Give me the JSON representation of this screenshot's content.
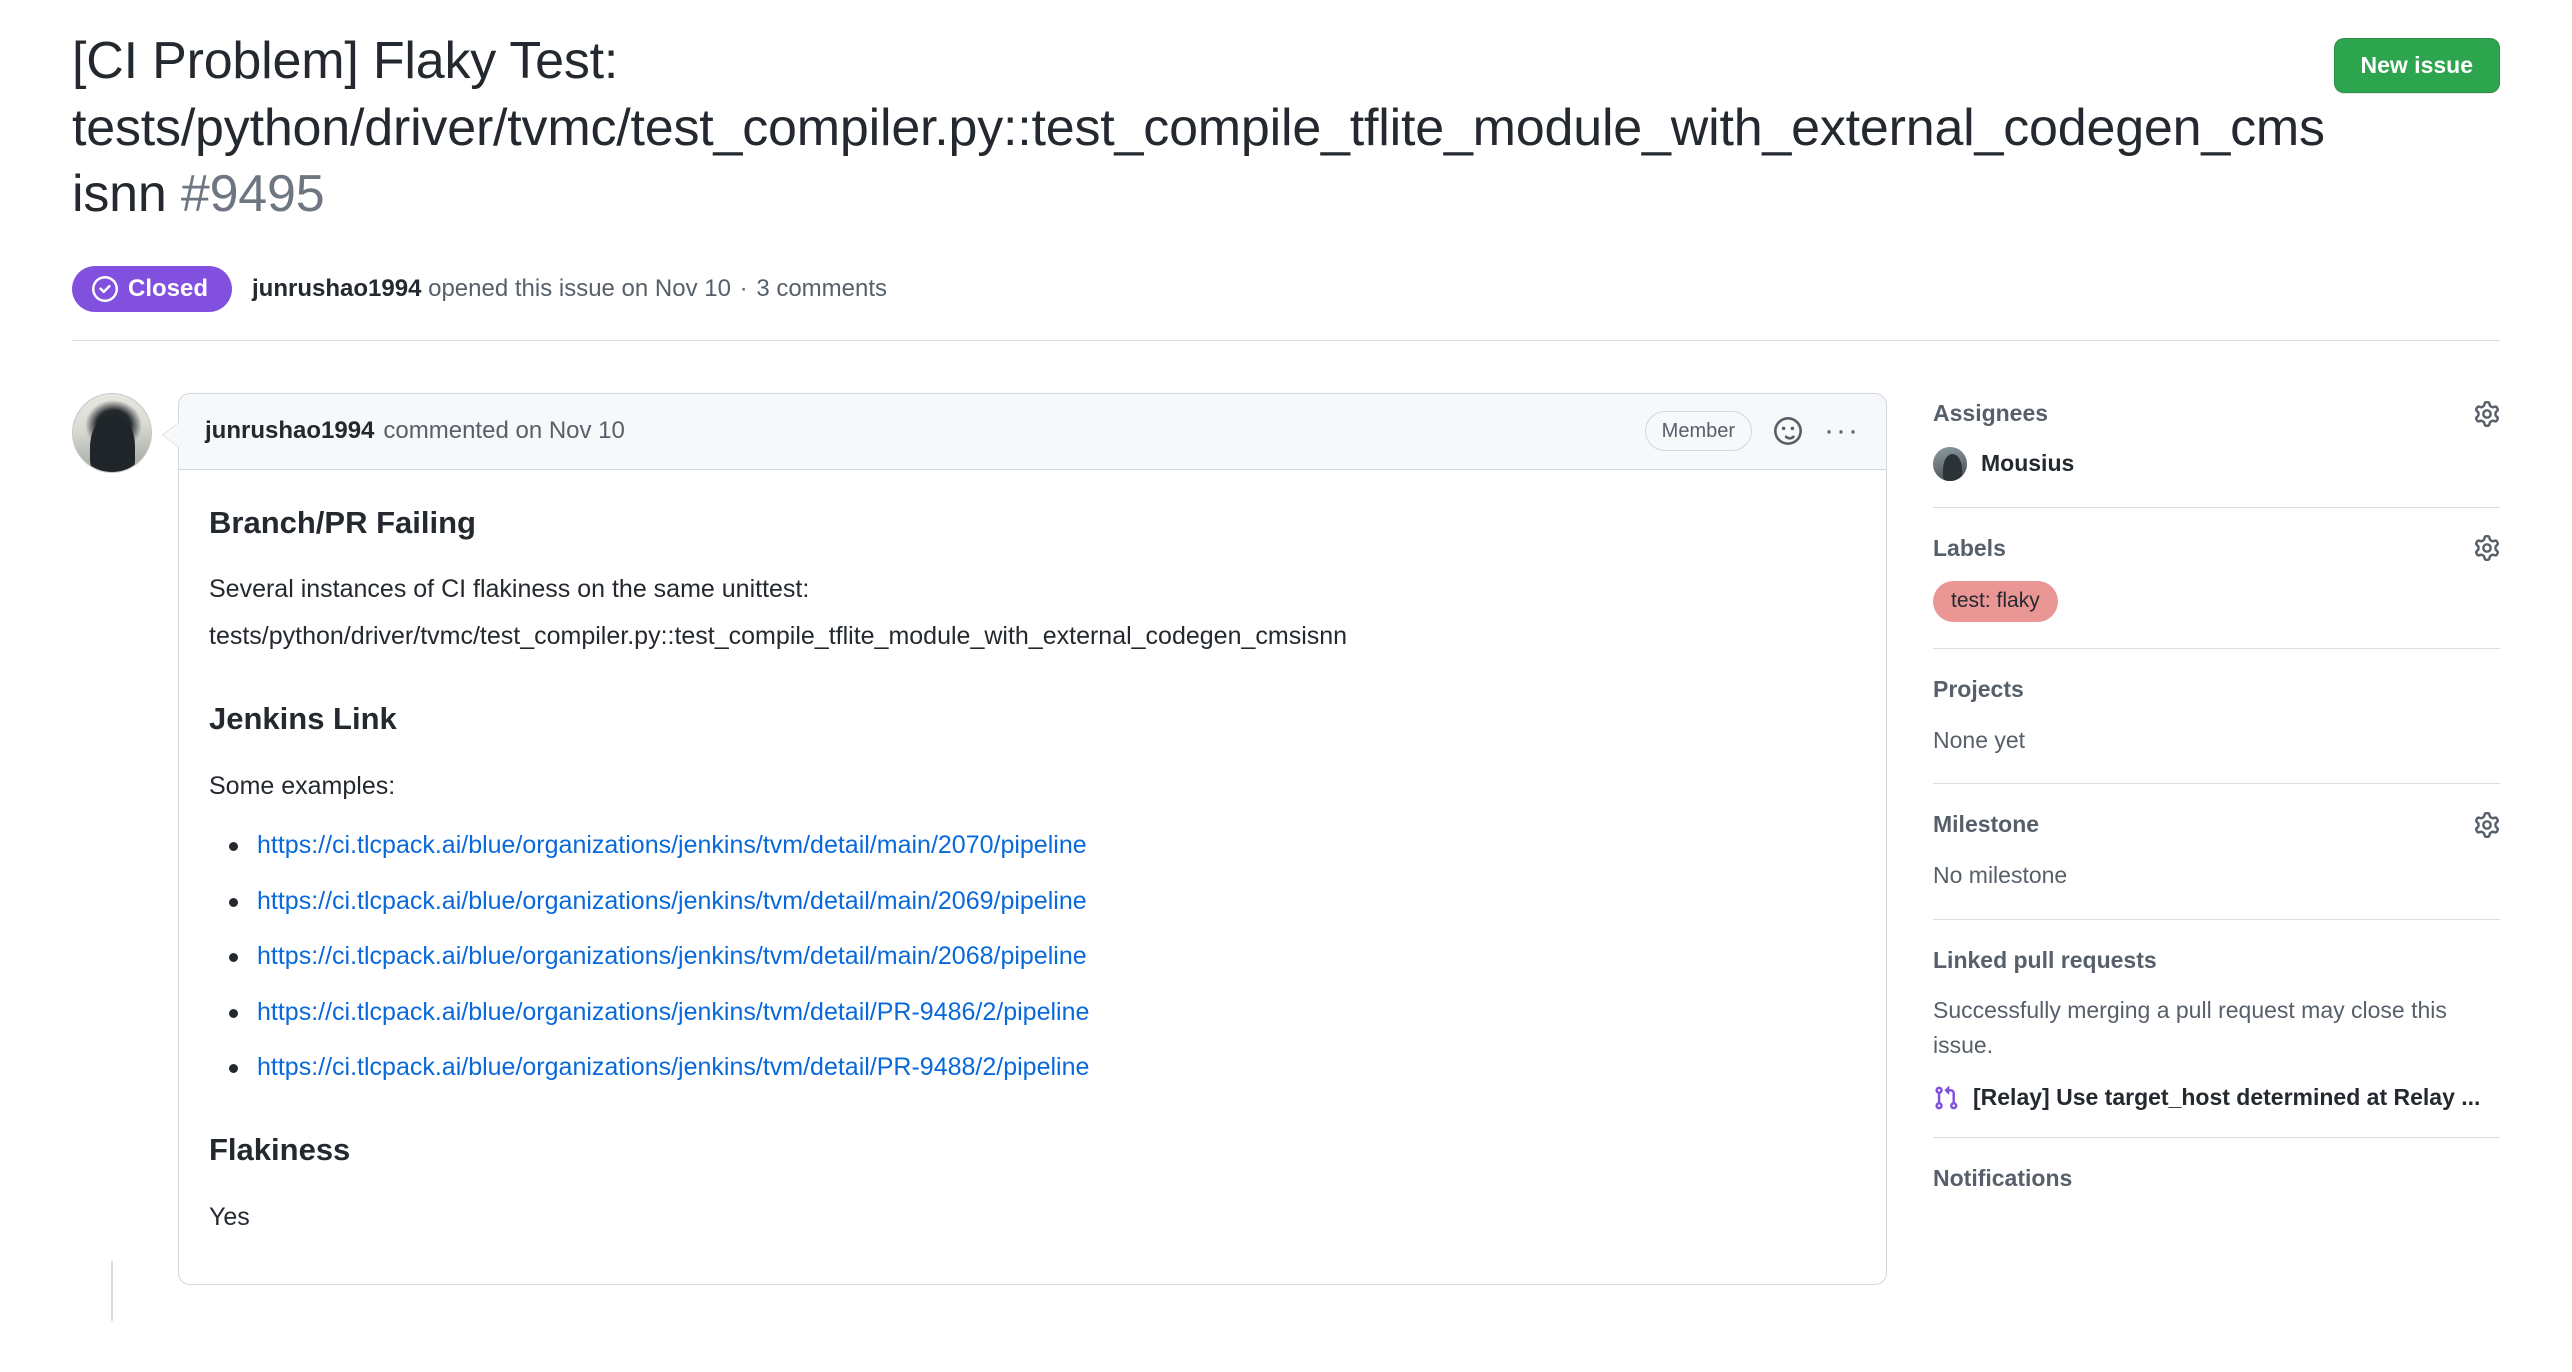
{
  "header": {
    "title_text": "[CI Problem] Flaky Test: tests/python/driver/tvmc/test_compiler.py::test_compile_tflite_module_with_external_codegen_cmsisnn",
    "issue_number": "#9495",
    "new_issue_button": "New issue"
  },
  "meta": {
    "state": "Closed",
    "author": "junrushao1994",
    "opened_text": "opened this issue on Nov 10",
    "separator": "·",
    "comments_count": "3 comments"
  },
  "comment": {
    "author": "junrushao1994",
    "meta": "commented on Nov 10",
    "association": "Member",
    "body": {
      "h1": "Branch/PR Failing",
      "p1": "Several instances of CI flakiness on the same unittest:",
      "p2": "tests/python/driver/tvmc/test_compiler.py::test_compile_tflite_module_with_external_codegen_cmsisnn",
      "h2": "Jenkins Link",
      "p3": "Some examples:",
      "links": [
        "https://ci.tlcpack.ai/blue/organizations/jenkins/tvm/detail/main/2070/pipeline",
        "https://ci.tlcpack.ai/blue/organizations/jenkins/tvm/detail/main/2069/pipeline",
        "https://ci.tlcpack.ai/blue/organizations/jenkins/tvm/detail/main/2068/pipeline",
        "https://ci.tlcpack.ai/blue/organizations/jenkins/tvm/detail/PR-9486/2/pipeline",
        "https://ci.tlcpack.ai/blue/organizations/jenkins/tvm/detail/PR-9488/2/pipeline"
      ],
      "h3": "Flakiness",
      "p4": "Yes"
    }
  },
  "sidebar": {
    "assignees": {
      "title": "Assignees",
      "name": "Mousius"
    },
    "labels": {
      "title": "Labels",
      "chip": "test: flaky"
    },
    "projects": {
      "title": "Projects",
      "value": "None yet"
    },
    "milestone": {
      "title": "Milestone",
      "value": "No milestone"
    },
    "linked_pull_requests": {
      "title": "Linked pull requests",
      "description": "Successfully merging a pull request may close this issue.",
      "pr_title": "[Relay] Use target_host determined at Relay ..."
    },
    "cut_off": {
      "title": "Notifications"
    }
  },
  "colors": {
    "closed_purple": "#8250df",
    "green_button": "#2da44e",
    "link_blue": "#0969da",
    "label_salmon": "#e99695",
    "border": "#d0d7de",
    "muted_text": "#57606a"
  }
}
